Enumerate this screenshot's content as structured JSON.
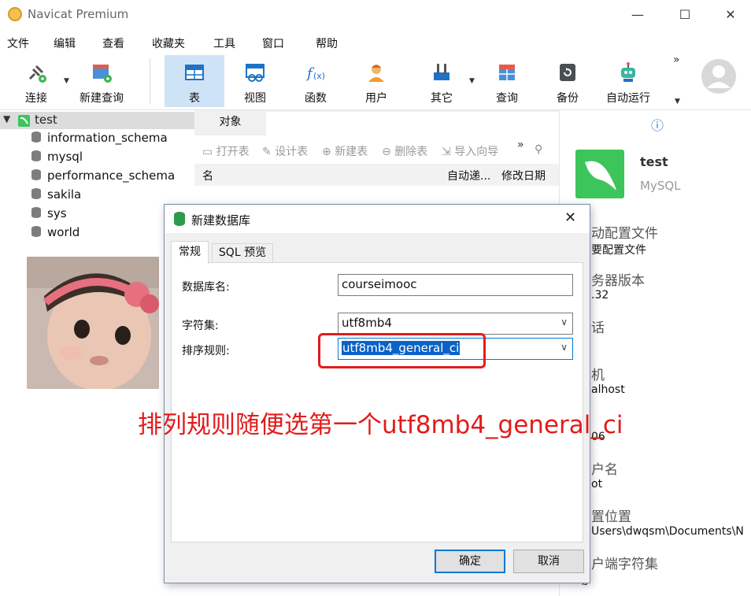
{
  "window": {
    "title": "Navicat Premium",
    "controls": {
      "minimize": "—",
      "maximize": "☐",
      "close": "✕"
    }
  },
  "menu": [
    "文件",
    "编辑",
    "查看",
    "收藏夹",
    "工具",
    "窗口",
    "帮助"
  ],
  "toolbar": {
    "items": [
      {
        "label": "连接",
        "icon": "plug-icon"
      },
      {
        "label": "新建查询",
        "icon": "new-query-icon"
      },
      {
        "label": "表",
        "icon": "table-icon",
        "active": true
      },
      {
        "label": "视图",
        "icon": "view-icon"
      },
      {
        "label": "函数",
        "icon": "function-icon"
      },
      {
        "label": "用户",
        "icon": "user-icon"
      },
      {
        "label": "其它",
        "icon": "tools-icon"
      },
      {
        "label": "查询",
        "icon": "query-icon"
      },
      {
        "label": "备份",
        "icon": "backup-icon"
      },
      {
        "label": "自动运行",
        "icon": "robot-icon"
      }
    ],
    "more": "»"
  },
  "tree": {
    "root": "test",
    "databases": [
      "information_schema",
      "mysql",
      "performance_schema",
      "sakila",
      "sys",
      "world"
    ]
  },
  "objects": {
    "tab": "对象",
    "actions": [
      "打开表",
      "设计表",
      "新建表",
      "删除表",
      "导入向导"
    ],
    "more": "»",
    "columns": [
      "名",
      "自动递...",
      "修改日期"
    ]
  },
  "info": {
    "name": "test",
    "type": "MySQL",
    "rows": [
      {
        "label": "动配置文件",
        "value": "要配置文件"
      },
      {
        "label": "务器版本",
        "value": ".32"
      },
      {
        "label": "话",
        "value": ""
      },
      {
        "label": "机",
        "value": "alhost"
      },
      {
        "label": "",
        "value": "06"
      },
      {
        "label": "户名",
        "value": "ot"
      },
      {
        "label": "置位置",
        "value": "Users\\dwqsm\\Documents\\N"
      },
      {
        "label": "户端字符集",
        "value": "动"
      }
    ]
  },
  "dialog": {
    "title": "新建数据库",
    "tabs": [
      "常规",
      "SQL 预览"
    ],
    "fields": {
      "db_name_label": "数据库名:",
      "db_name_value": "courseimooc",
      "charset_label": "字符集:",
      "charset_value": "utf8mb4",
      "collation_label": "排序规则:",
      "collation_value": "utf8mb4_general_ci"
    },
    "ok": "确定",
    "cancel": "取消"
  },
  "annotation": {
    "text": "排列规则随便选第一个utf8mb4_general_ci",
    "color": "#e31b1b"
  },
  "colors": {
    "accent": "#0078d7",
    "active_tool": "#cfe3f7",
    "brand_green": "#3cc55a"
  }
}
